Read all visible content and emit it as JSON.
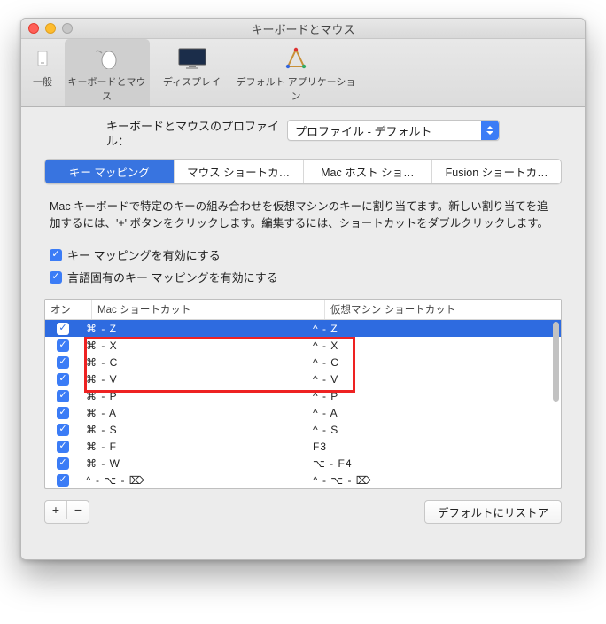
{
  "window": {
    "title": "キーボードとマウス"
  },
  "toolbar": {
    "items": [
      {
        "label": "一般"
      },
      {
        "label": "キーボードとマウス"
      },
      {
        "label": "ディスプレイ"
      },
      {
        "label": "デフォルト アプリケーション"
      }
    ]
  },
  "profile": {
    "label": "キーボードとマウスのプロファイル：",
    "value": "プロファイル - デフォルト"
  },
  "tabs": [
    "キー マッピング",
    "マウス ショートカ…",
    "Mac ホスト ショ…",
    "Fusion ショートカ…"
  ],
  "description": "Mac キーボードで特定のキーの組み合わせを仮想マシンのキーに割り当てます。新しい割り当てを追加するには、'+' ボタンをクリックします。編集するには、ショートカットをダブルクリックします。",
  "checkboxes": {
    "enable_mapping": "キー マッピングを有効にする",
    "enable_lang": "言語固有のキー マッピングを有効にする"
  },
  "table": {
    "headers": {
      "on": "オン",
      "mac": "Mac ショートカット",
      "vm": "仮想マシン ショートカット"
    },
    "rows": [
      {
        "mac": "⌘ - Z",
        "vm": "^ - Z",
        "selected": true
      },
      {
        "mac": "⌘ - X",
        "vm": "^ - X"
      },
      {
        "mac": "⌘ - C",
        "vm": "^ - C"
      },
      {
        "mac": "⌘ - V",
        "vm": "^ - V"
      },
      {
        "mac": "⌘ - P",
        "vm": "^ - P"
      },
      {
        "mac": "⌘ - A",
        "vm": "^ - A"
      },
      {
        "mac": "⌘ - S",
        "vm": "^ - S"
      },
      {
        "mac": "⌘ - F",
        "vm": "F3"
      },
      {
        "mac": "⌘ - W",
        "vm": "⌥ - F4"
      },
      {
        "mac": "^ - ⌥ - ⌦",
        "vm": "^ - ⌥ - ⌦"
      }
    ]
  },
  "footer": {
    "restore": "デフォルトにリストア",
    "plus": "+",
    "minus": "−"
  }
}
